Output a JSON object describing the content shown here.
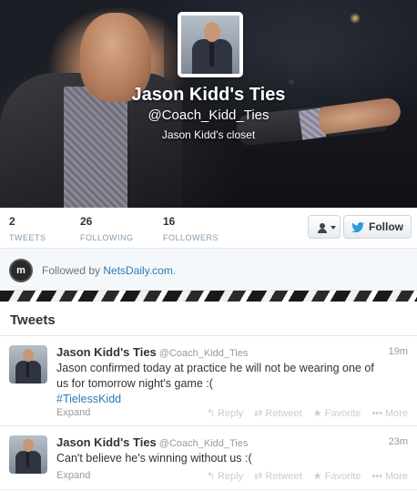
{
  "profile": {
    "name": "Jason Kidd's Ties",
    "handle": "@Coach_Kidd_Ties",
    "bio": "Jason Kidd's closet"
  },
  "stats": {
    "tweets": {
      "value": "2",
      "label": "TWEETS"
    },
    "following": {
      "value": "26",
      "label": "FOLLOWING"
    },
    "followers": {
      "value": "16",
      "label": "FOLLOWERS"
    }
  },
  "actions": {
    "follow_label": "Follow"
  },
  "followed_by": {
    "prefix": "Followed by",
    "account": "NetsDaily.com",
    "suffix": "."
  },
  "tweets_header": "Tweets",
  "tweets": [
    {
      "name": "Jason Kidd's Ties",
      "handle": "@Coach_Kidd_Ties",
      "time": "19m",
      "text": "Jason confirmed today at practice he will not be wearing one of us for tomorrow night's game :(",
      "hashtag": "#TielessKidd",
      "expand": "Expand"
    },
    {
      "name": "Jason Kidd's Ties",
      "handle": "@Coach_Kidd_Ties",
      "time": "23m",
      "text": "Can't believe he's winning without us :(",
      "expand": "Expand"
    }
  ],
  "tweet_actions": {
    "reply": "Reply",
    "retweet": "Retweet",
    "favorite": "Favorite",
    "more": "More"
  },
  "colors": {
    "link": "#2b7bb9",
    "muted": "#999999",
    "border": "#e1e8ed"
  }
}
